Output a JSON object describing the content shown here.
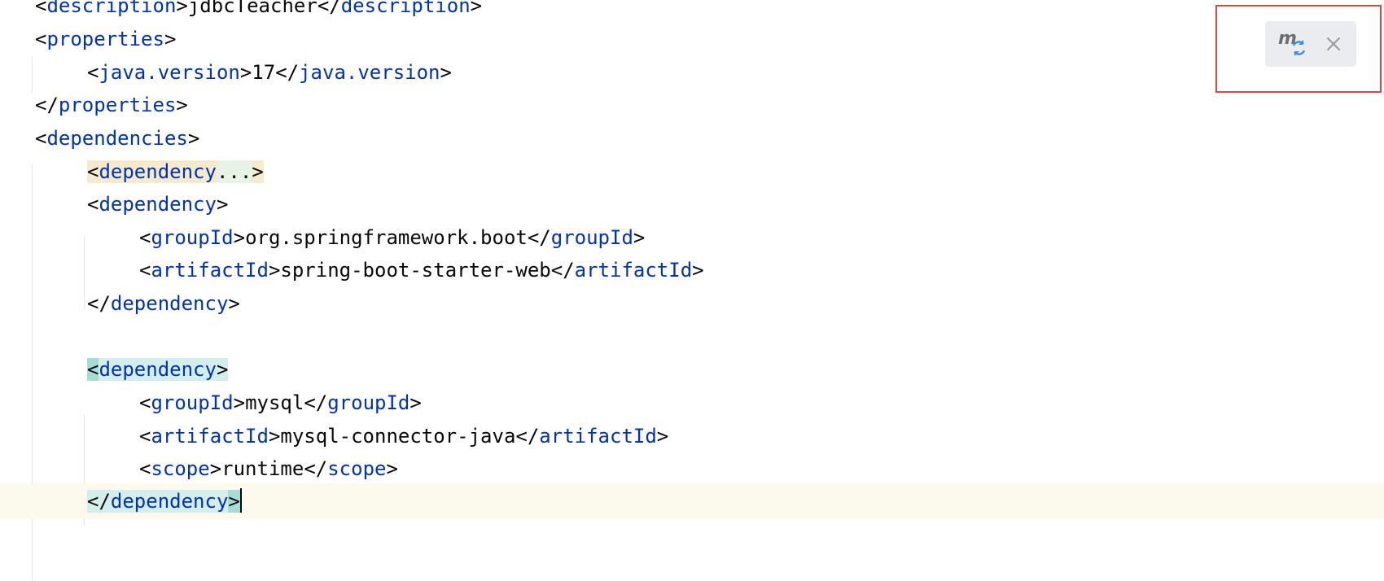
{
  "editor": {
    "lines": [
      {
        "segments": [
          {
            "k": "p",
            "t": "<"
          },
          {
            "k": "t",
            "t": "description"
          },
          {
            "k": "p",
            "t": ">"
          },
          {
            "k": "x",
            "t": "jdbcTeacher"
          },
          {
            "k": "p",
            "t": "</"
          },
          {
            "k": "t",
            "t": "description"
          },
          {
            "k": "p",
            "t": ">"
          }
        ]
      },
      {
        "segments": [
          {
            "k": "p",
            "t": "<"
          },
          {
            "k": "t",
            "t": "properties"
          },
          {
            "k": "p",
            "t": ">"
          }
        ]
      },
      {
        "segments": [
          {
            "k": "p",
            "t": "<"
          },
          {
            "k": "t",
            "t": "java.version"
          },
          {
            "k": "p",
            "t": ">"
          },
          {
            "k": "x",
            "t": "17"
          },
          {
            "k": "p",
            "t": "</"
          },
          {
            "k": "t",
            "t": "java.version"
          },
          {
            "k": "p",
            "t": ">"
          }
        ]
      },
      {
        "segments": [
          {
            "k": "p",
            "t": "</"
          },
          {
            "k": "t",
            "t": "properties"
          },
          {
            "k": "p",
            "t": ">"
          }
        ]
      },
      {
        "segments": [
          {
            "k": "p",
            "t": "<"
          },
          {
            "k": "t",
            "t": "dependencies"
          },
          {
            "k": "p",
            "t": ">"
          }
        ]
      },
      {
        "segments": [
          {
            "k": "p",
            "t": "<",
            "h": "fold"
          },
          {
            "k": "t",
            "t": "dependency",
            "h": "fold"
          },
          {
            "k": "x",
            "t": "...",
            "h": "fold-dots"
          },
          {
            "k": "p",
            "t": ">",
            "h": "fold"
          }
        ]
      },
      {
        "segments": [
          {
            "k": "p",
            "t": "<"
          },
          {
            "k": "t",
            "t": "dependency"
          },
          {
            "k": "p",
            "t": ">"
          }
        ]
      },
      {
        "segments": [
          {
            "k": "p",
            "t": "<"
          },
          {
            "k": "t",
            "t": "groupId"
          },
          {
            "k": "p",
            "t": ">"
          },
          {
            "k": "x",
            "t": "org.springframework.boot"
          },
          {
            "k": "p",
            "t": "</"
          },
          {
            "k": "t",
            "t": "groupId"
          },
          {
            "k": "p",
            "t": ">"
          }
        ]
      },
      {
        "segments": [
          {
            "k": "p",
            "t": "<"
          },
          {
            "k": "t",
            "t": "artifactId"
          },
          {
            "k": "p",
            "t": ">"
          },
          {
            "k": "x",
            "t": "spring-boot-starter-web"
          },
          {
            "k": "p",
            "t": "</"
          },
          {
            "k": "t",
            "t": "artifactId"
          },
          {
            "k": "p",
            "t": ">"
          }
        ]
      },
      {
        "segments": [
          {
            "k": "p",
            "t": "</"
          },
          {
            "k": "t",
            "t": "dependency"
          },
          {
            "k": "p",
            "t": ">"
          }
        ]
      },
      {
        "segments": []
      },
      {
        "segments": [
          {
            "k": "p",
            "t": "<",
            "h": "match-edge"
          },
          {
            "k": "t",
            "t": "dependency",
            "h": "match"
          },
          {
            "k": "p",
            "t": ">",
            "h": "match"
          }
        ]
      },
      {
        "segments": [
          {
            "k": "p",
            "t": "<"
          },
          {
            "k": "t",
            "t": "groupId"
          },
          {
            "k": "p",
            "t": ">"
          },
          {
            "k": "x",
            "t": "mysql"
          },
          {
            "k": "p",
            "t": "</"
          },
          {
            "k": "t",
            "t": "groupId"
          },
          {
            "k": "p",
            "t": ">"
          }
        ]
      },
      {
        "segments": [
          {
            "k": "p",
            "t": "<"
          },
          {
            "k": "t",
            "t": "artifactId"
          },
          {
            "k": "p",
            "t": ">"
          },
          {
            "k": "x",
            "t": "mysql-connector-java"
          },
          {
            "k": "p",
            "t": "</"
          },
          {
            "k": "t",
            "t": "artifactId"
          },
          {
            "k": "p",
            "t": ">"
          }
        ]
      },
      {
        "segments": [
          {
            "k": "p",
            "t": "<"
          },
          {
            "k": "t",
            "t": "scope"
          },
          {
            "k": "p",
            "t": ">"
          },
          {
            "k": "x",
            "t": "runtime"
          },
          {
            "k": "p",
            "t": "</"
          },
          {
            "k": "t",
            "t": "scope"
          },
          {
            "k": "p",
            "t": ">"
          }
        ]
      },
      {
        "segments": [
          {
            "k": "p",
            "t": "</",
            "h": "match"
          },
          {
            "k": "t",
            "t": "dependency",
            "h": "match"
          },
          {
            "k": "p",
            "t": ">",
            "h": "match-edge"
          }
        ],
        "current": true,
        "caret": true
      }
    ]
  },
  "notification": {
    "maven_icon": "maven-reload-icon",
    "close_icon": "close-icon",
    "colors": {
      "m": "#6e6e6e",
      "reload": "#3f8fd8",
      "close": "#9a9a9a"
    }
  }
}
